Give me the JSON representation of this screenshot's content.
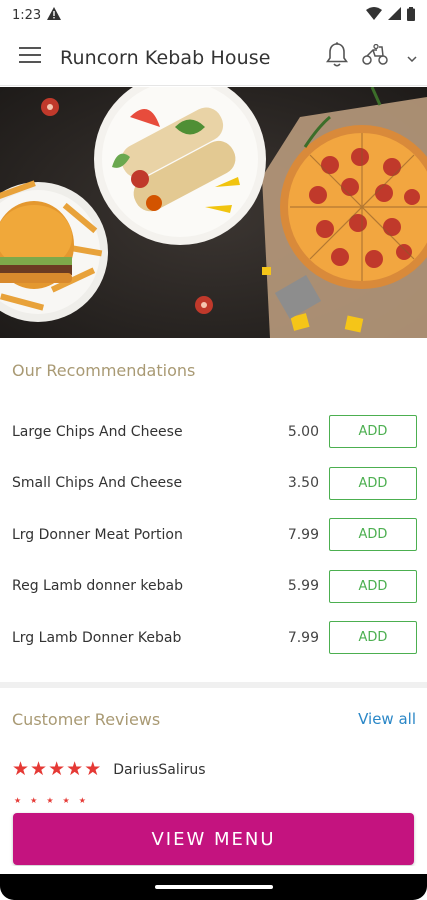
{
  "status_bar": {
    "time": "1:23"
  },
  "app_bar": {
    "title": "Runcorn Kebab House"
  },
  "icons": {
    "menu": "hamburger-icon",
    "bell": "bell-icon",
    "delivery": "scooter-icon",
    "dropdown": "chevron-down-icon"
  },
  "recommendations": {
    "title": "Our Recommendations",
    "items": [
      {
        "name": "Large Chips And Cheese",
        "price": "5.00",
        "action": "ADD"
      },
      {
        "name": "Small Chips And Cheese",
        "price": "3.50",
        "action": "ADD"
      },
      {
        "name": "Lrg Donner Meat Portion",
        "price": "7.99",
        "action": "ADD"
      },
      {
        "name": "Reg Lamb donner kebab",
        "price": "5.99",
        "action": "ADD"
      },
      {
        "name": "Lrg Lamb Donner Kebab",
        "price": "7.99",
        "action": "ADD"
      }
    ]
  },
  "reviews": {
    "title": "Customer Reviews",
    "view_all": "View all",
    "items": [
      {
        "reviewer": "DariusSalirus",
        "rating": 5
      }
    ]
  },
  "cta": {
    "view_menu": "VIEW MENU"
  },
  "colors": {
    "accent": "#c4137f",
    "add_green": "#4caf50",
    "link_blue": "#2a87c7",
    "star_red": "#e53935",
    "section_gold": "#a99a74"
  }
}
